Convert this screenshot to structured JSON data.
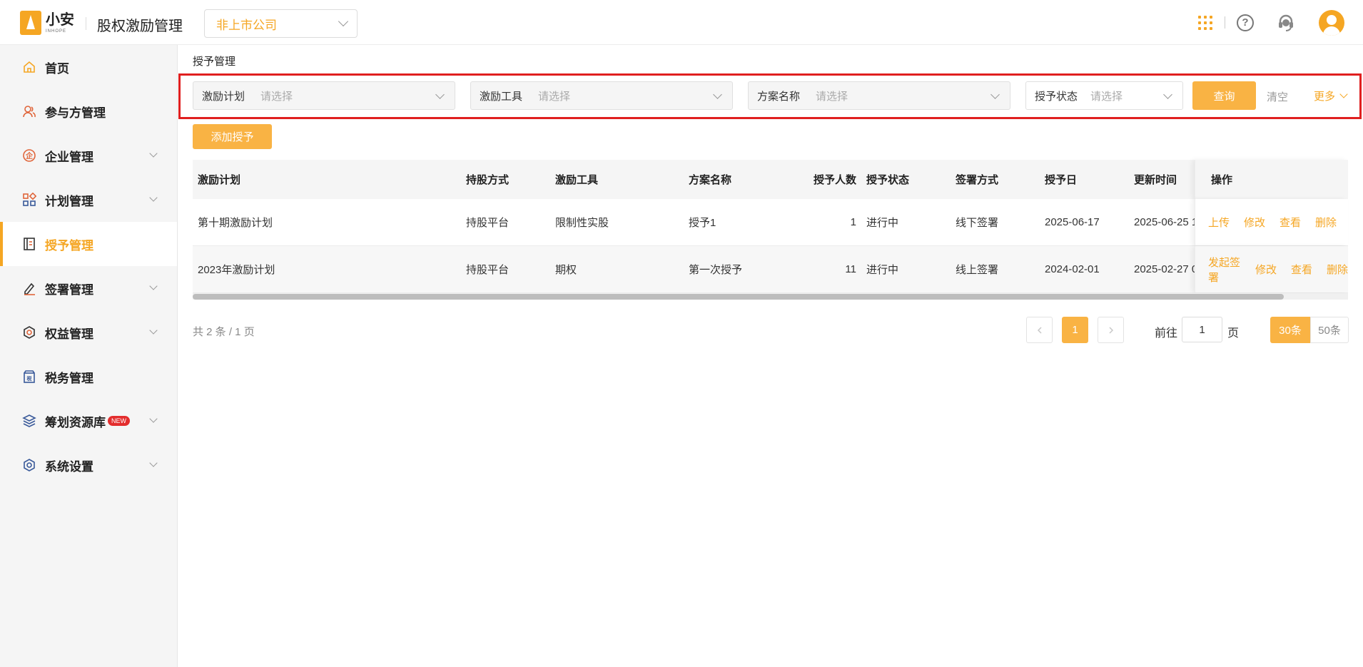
{
  "header": {
    "logo_cn": "小安",
    "logo_en": "INHOPE",
    "app_title": "股权激励管理",
    "company_select": "非上市公司",
    "icons": [
      "apps-grid-icon",
      "help-icon",
      "customer-service-icon",
      "user-avatar-icon"
    ],
    "accent_color": "#f5a623"
  },
  "sidebar": {
    "items": [
      {
        "label": "首页",
        "icon": "home-icon",
        "expandable": false,
        "active": false
      },
      {
        "label": "参与方管理",
        "icon": "participants-icon",
        "expandable": false,
        "active": false
      },
      {
        "label": "企业管理",
        "icon": "enterprise-icon",
        "expandable": true,
        "active": false
      },
      {
        "label": "计划管理",
        "icon": "plan-grid-icon",
        "expandable": true,
        "active": false
      },
      {
        "label": "授予管理",
        "icon": "grant-book-icon",
        "expandable": false,
        "active": true
      },
      {
        "label": "签署管理",
        "icon": "sign-pen-icon",
        "expandable": true,
        "active": false
      },
      {
        "label": "权益管理",
        "icon": "equity-icon",
        "expandable": true,
        "active": false
      },
      {
        "label": "税务管理",
        "icon": "tax-icon",
        "expandable": false,
        "active": false
      },
      {
        "label": "筹划资源库",
        "icon": "layers-icon",
        "expandable": true,
        "active": false,
        "badge": "NEW"
      },
      {
        "label": "系统设置",
        "icon": "settings-icon",
        "expandable": true,
        "active": false
      }
    ]
  },
  "main": {
    "breadcrumb": "授予管理",
    "filters": [
      {
        "label": "激励计划",
        "placeholder": "请选择"
      },
      {
        "label": "激励工具",
        "placeholder": "请选择"
      },
      {
        "label": "方案名称",
        "placeholder": "请选择"
      },
      {
        "label": "授予状态",
        "placeholder": "请选择"
      }
    ],
    "query_label": "查询",
    "clear_label": "清空",
    "more_label": "更多",
    "add_label": "添加授予",
    "table": {
      "columns": [
        "激励计划",
        "持股方式",
        "激励工具",
        "方案名称",
        "授予人数",
        "授予状态",
        "签署方式",
        "授予日",
        "更新时间",
        "操作"
      ],
      "rows": [
        {
          "plan": "第十期激励计划",
          "holding": "持股平台",
          "tool": "限制性实股",
          "scheme": "授予1",
          "count": "1",
          "status": "进行中",
          "sign": "线下签署",
          "grant_date": "2025-06-17",
          "updated": "2025-06-25 1",
          "actions": [
            "上传",
            "修改",
            "查看",
            "删除"
          ]
        },
        {
          "plan": "2023年激励计划",
          "holding": "持股平台",
          "tool": "期权",
          "scheme": "第一次授予",
          "count": "11",
          "status": "进行中",
          "sign": "线上签署",
          "grant_date": "2024-02-01",
          "updated": "2025-02-27 0",
          "actions": [
            "发起签署",
            "修改",
            "查看",
            "删除"
          ]
        }
      ]
    },
    "pagination": {
      "summary": "共 2 条 / 1 页",
      "current_page": "1",
      "goto_label": "前往",
      "goto_value": "1",
      "goto_suffix": "页",
      "size_options": [
        "30条",
        "50条"
      ]
    }
  }
}
